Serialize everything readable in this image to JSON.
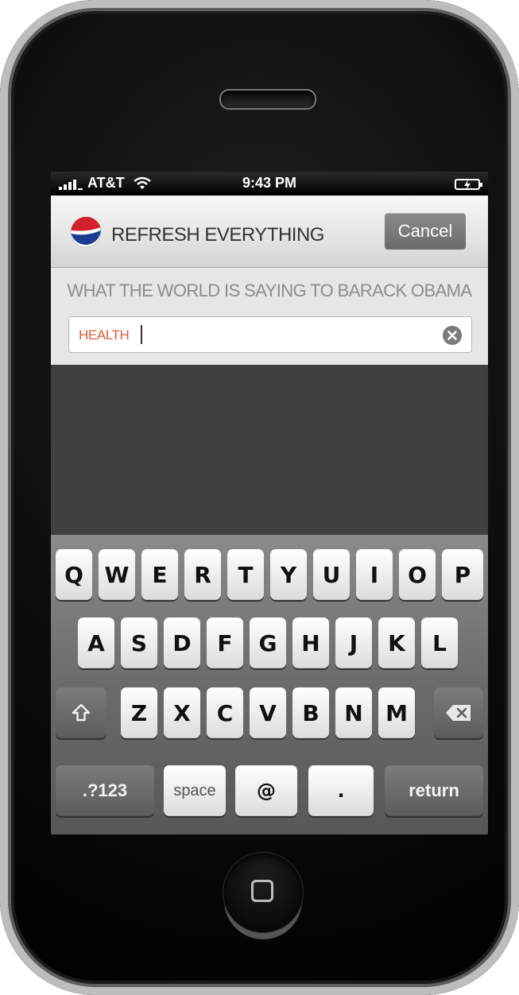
{
  "status_bar": {
    "carrier": "AT&T",
    "time": "9:43 PM",
    "icons": [
      "signal-icon",
      "wifi-icon",
      "battery-charging-icon"
    ]
  },
  "header": {
    "brand": "REFRESH EVERYTHING",
    "logo_icon": "pepsi-logo-icon",
    "cancel_label": "Cancel"
  },
  "search": {
    "prompt": "WHAT THE WORLD IS SAYING TO BARACK OBAMA",
    "value": "HEALTH",
    "clear_icon": "clear-icon"
  },
  "keyboard": {
    "row1": [
      "Q",
      "W",
      "E",
      "R",
      "T",
      "Y",
      "U",
      "I",
      "O",
      "P"
    ],
    "row2": [
      "A",
      "S",
      "D",
      "F",
      "G",
      "H",
      "J",
      "K",
      "L"
    ],
    "row3": [
      "Z",
      "X",
      "C",
      "V",
      "B",
      "N",
      "M"
    ],
    "bottom": {
      "numbers": ".?123",
      "space": "space",
      "at": "@",
      "period": ".",
      "return": "return"
    },
    "shift_icon": "shift-icon",
    "delete_icon": "backspace-icon"
  },
  "colors": {
    "accent_text": "#e05a3a",
    "pepsi_blue": "#1a3d8f",
    "pepsi_red": "#d3202e"
  }
}
